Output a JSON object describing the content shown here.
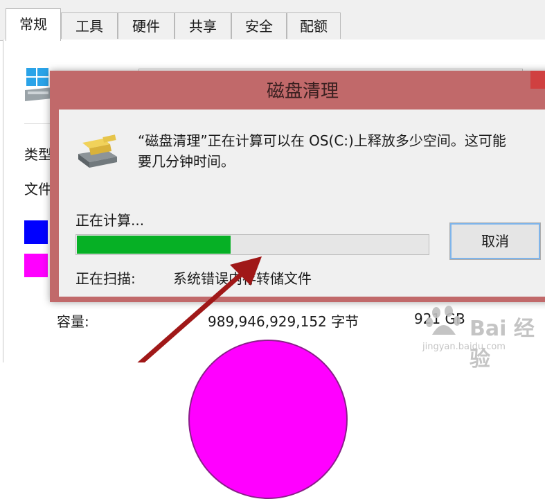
{
  "properties_window": {
    "tabs": [
      {
        "label": "常规",
        "active": true
      },
      {
        "label": "工具",
        "active": false
      },
      {
        "label": "硬件",
        "active": false
      },
      {
        "label": "共享",
        "active": false
      },
      {
        "label": "安全",
        "active": false
      },
      {
        "label": "配额",
        "active": false
      }
    ],
    "type_label": "类型",
    "filesystem_label": "文件",
    "capacity_label": "容量:",
    "capacity_bytes": "989,946,929,152 字节",
    "capacity_gb": "921 GB",
    "colors": {
      "used": "#0000ff",
      "free": "#ff00ff"
    }
  },
  "dialog": {
    "title": "磁盘清理",
    "message": "“磁盘清理”正在计算可以在 OS(C:)上释放多少空间。这可能\n要几分钟时间。",
    "status": "正在计算...",
    "progress_percent": 44,
    "scanning_label": "正在扫描:",
    "scanning_item": "系统错误内存转储文件",
    "cancel_label": "取消",
    "colors": {
      "title_bar": "#c1696a",
      "progress": "#06b025"
    }
  },
  "watermark": {
    "brand": "Bai 经验",
    "site": "jingyan.baidu.com"
  }
}
